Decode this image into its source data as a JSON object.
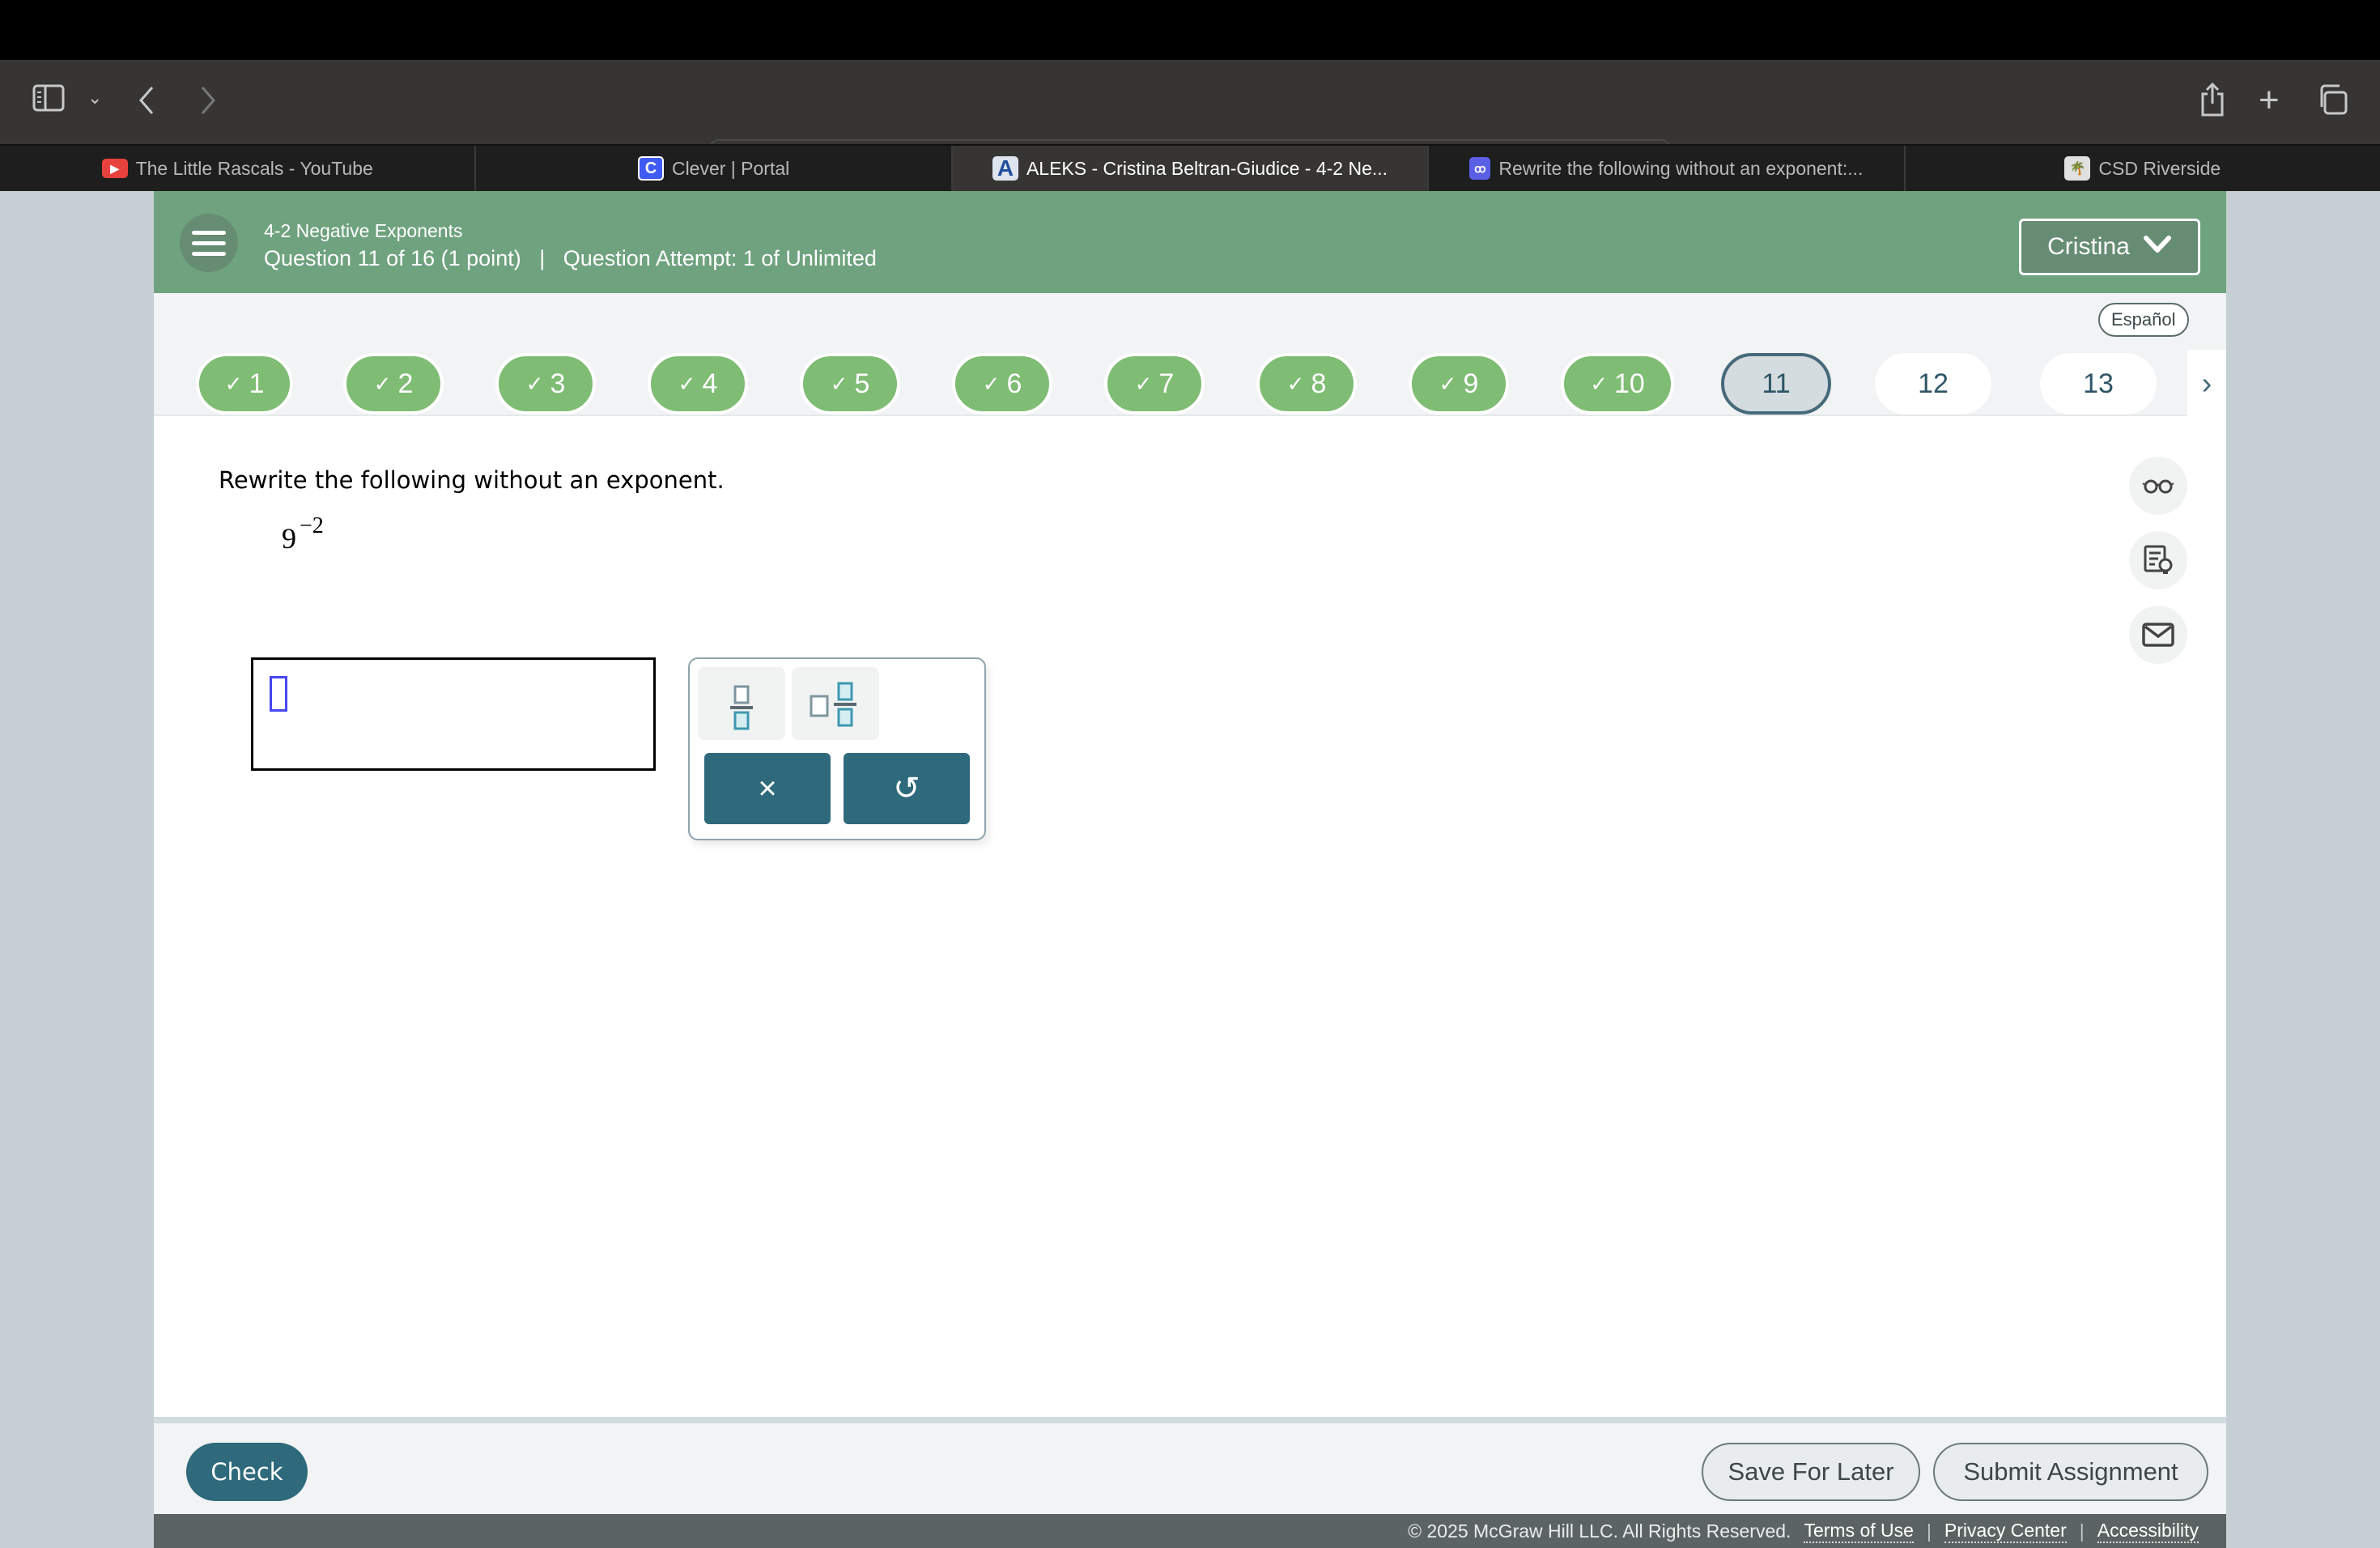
{
  "browser": {
    "url": "www-awy.aleks.com",
    "tabs": [
      {
        "label": "The Little Rascals - YouTube",
        "icon": "youtube-icon",
        "color": "#e8423f",
        "active": false
      },
      {
        "label": "Clever | Portal",
        "icon": "clever-icon",
        "color": "#3f5bf2",
        "active": false
      },
      {
        "label": "ALEKS - Cristina Beltran-Giudice - 4-2 Ne...",
        "icon": "aleks-icon",
        "color": "#1f4e9c",
        "active": true
      },
      {
        "label": "Rewrite the following without an exponent:...",
        "icon": "mathway-icon",
        "color": "#5a5fe6",
        "active": false
      },
      {
        "label": "CSD Riverside",
        "icon": "csd-icon",
        "color": "#e0e0e0",
        "active": false
      }
    ]
  },
  "header": {
    "topic": "4-2 Negative Exponents",
    "question_info": "Question 11 of 16 (1 point)",
    "separator": "|",
    "attempt_info": "Question Attempt: 1 of Unlimited",
    "user_name": "Cristina"
  },
  "nav": {
    "language_label": "Español",
    "questions": [
      {
        "label": "1",
        "status": "done"
      },
      {
        "label": "2",
        "status": "done"
      },
      {
        "label": "3",
        "status": "done"
      },
      {
        "label": "4",
        "status": "done"
      },
      {
        "label": "5",
        "status": "done"
      },
      {
        "label": "6",
        "status": "done"
      },
      {
        "label": "7",
        "status": "done"
      },
      {
        "label": "8",
        "status": "done"
      },
      {
        "label": "9",
        "status": "done"
      },
      {
        "label": "10",
        "status": "done"
      },
      {
        "label": "11",
        "status": "current"
      },
      {
        "label": "12",
        "status": "todo"
      },
      {
        "label": "13",
        "status": "todo"
      }
    ],
    "check_glyph": "✓",
    "next_glyph": "›"
  },
  "question": {
    "prompt": "Rewrite the following without an exponent.",
    "base": "9",
    "exponent": "−2",
    "answer_value": ""
  },
  "palette": {
    "clear_glyph": "×",
    "undo_glyph": "↺"
  },
  "colors": {
    "header_green": "#6fa27e",
    "done_green": "#7fbc74",
    "accent_teal": "#2e6a7b"
  },
  "footer": {
    "check_label": "Check",
    "save_label": "Save For Later",
    "submit_label": "Submit Assignment",
    "copyright": "© 2025 McGraw Hill LLC. All Rights Reserved.",
    "links": [
      "Terms of Use",
      "Privacy Center",
      "Accessibility"
    ]
  }
}
